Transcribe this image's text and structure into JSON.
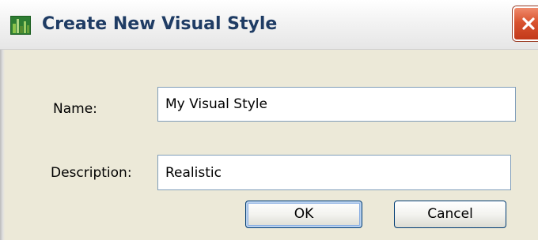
{
  "window": {
    "title": "Create New Visual Style",
    "icon": "visual-style-app-icon",
    "close_icon": "close-x-icon",
    "accent_color": "#1f3c64",
    "close_color": "#d9532f"
  },
  "form": {
    "name_label": "Name:",
    "name_value": "My Visual Style",
    "description_label": "Description:",
    "description_value": "Realistic"
  },
  "buttons": {
    "ok_label": "OK",
    "cancel_label": "Cancel"
  }
}
